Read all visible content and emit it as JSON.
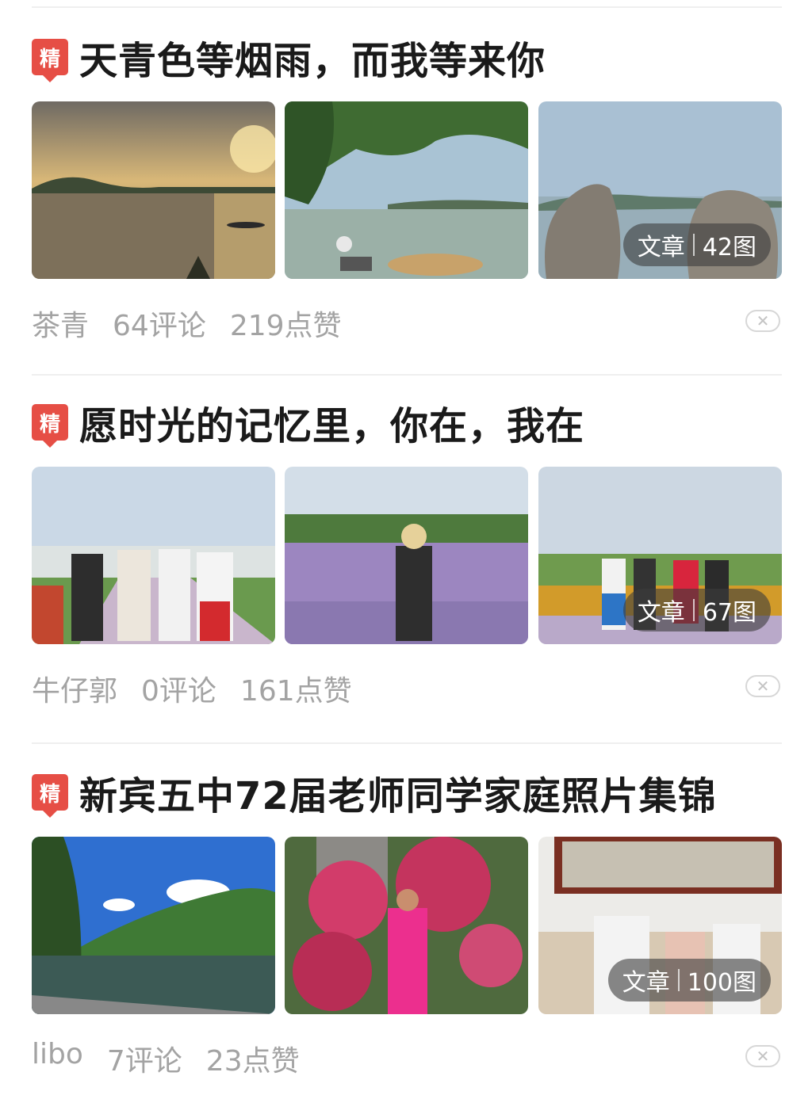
{
  "posts": [
    {
      "badge": "精",
      "title": "天青色等烟雨，而我等来你",
      "type_label": "文章",
      "photo_count": "42图",
      "author": "茶青",
      "comments": "64评论",
      "likes": "219点赞",
      "dismiss": "✕"
    },
    {
      "badge": "精",
      "title": "愿时光的记忆里，你在，我在",
      "type_label": "文章",
      "photo_count": "67图",
      "author": "牛仔郭",
      "comments": "0评论",
      "likes": "161点赞",
      "dismiss": "✕"
    },
    {
      "badge": "精",
      "title": "新宾五中72届老师同学家庭照片集锦",
      "type_label": "文章",
      "photo_count": "100图",
      "author": "libo",
      "comments": "7评论",
      "likes": "23点赞",
      "dismiss": "✕"
    }
  ]
}
